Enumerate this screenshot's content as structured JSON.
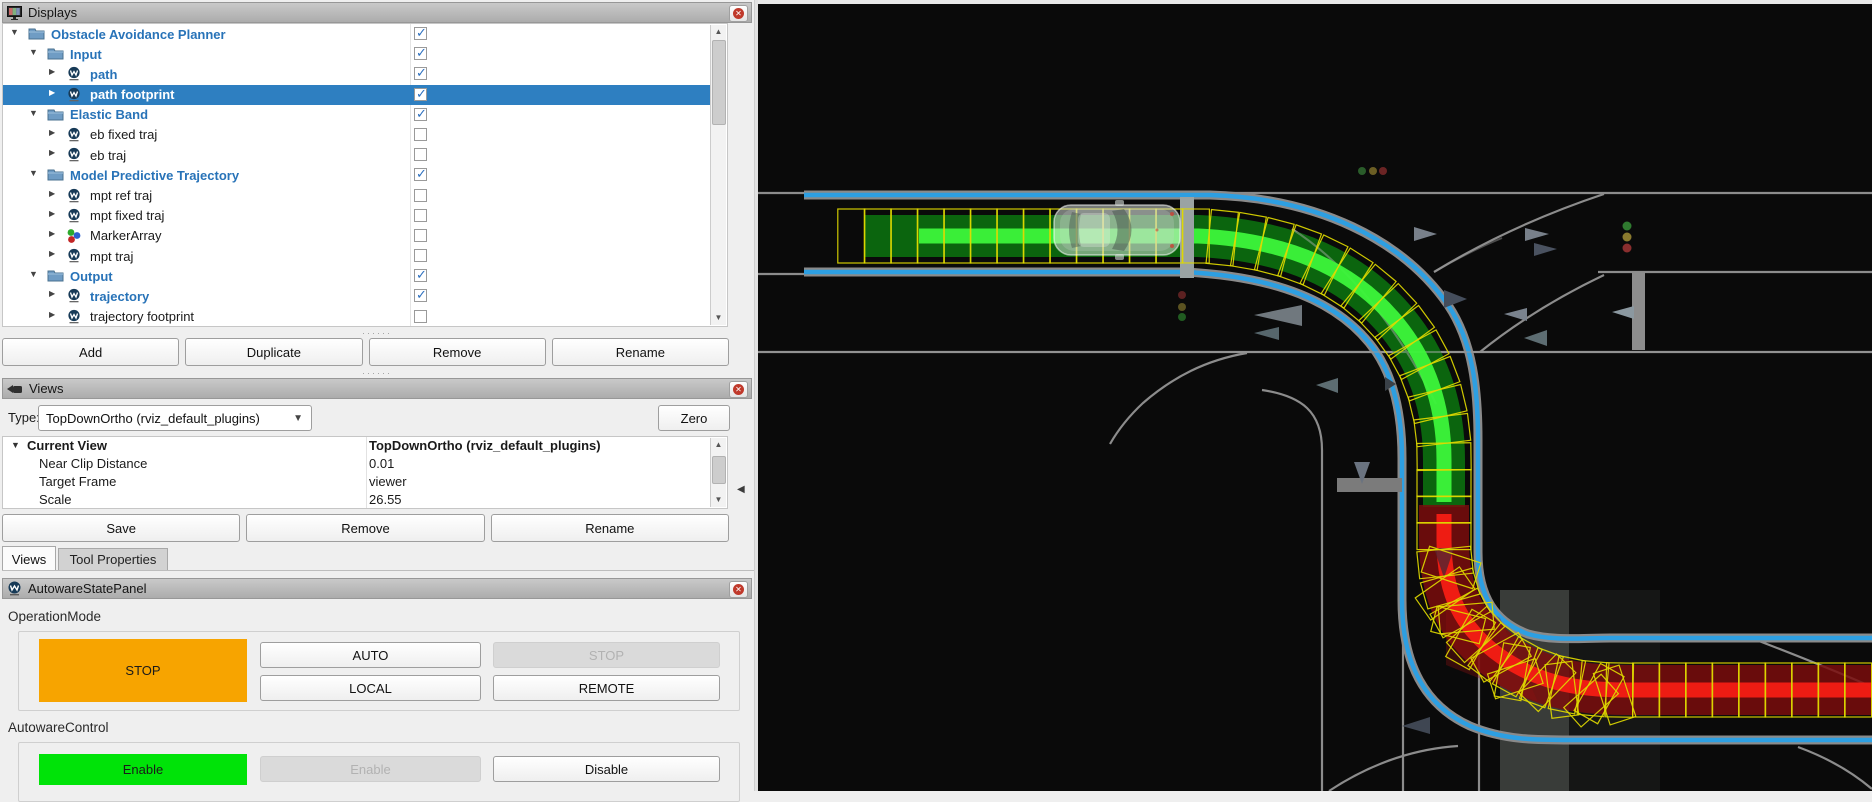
{
  "displays_panel": {
    "title": "Displays",
    "tree": [
      {
        "label": "Obstacle Avoidance Planner",
        "level": 0,
        "icon": "folder",
        "expanded": true,
        "checked": true,
        "blue": true,
        "selected": false
      },
      {
        "label": "Input",
        "level": 1,
        "icon": "folder",
        "expanded": true,
        "checked": true,
        "blue": true,
        "selected": false
      },
      {
        "label": "path",
        "level": 2,
        "icon": "autoware",
        "expanded": false,
        "checked": true,
        "blue": true,
        "selected": false
      },
      {
        "label": "path footprint",
        "level": 2,
        "icon": "autoware",
        "expanded": false,
        "checked": true,
        "blue": false,
        "selected": true
      },
      {
        "label": "Elastic Band",
        "level": 1,
        "icon": "folder",
        "expanded": true,
        "checked": true,
        "blue": true,
        "selected": false
      },
      {
        "label": "eb fixed traj",
        "level": 2,
        "icon": "autoware",
        "expanded": false,
        "checked": false,
        "blue": false,
        "selected": false
      },
      {
        "label": "eb traj",
        "level": 2,
        "icon": "autoware",
        "expanded": false,
        "checked": false,
        "blue": false,
        "selected": false
      },
      {
        "label": "Model Predictive Trajectory",
        "level": 1,
        "icon": "folder",
        "expanded": true,
        "checked": true,
        "blue": true,
        "selected": false
      },
      {
        "label": "mpt ref traj",
        "level": 2,
        "icon": "autoware",
        "expanded": false,
        "checked": false,
        "blue": false,
        "selected": false
      },
      {
        "label": "mpt fixed traj",
        "level": 2,
        "icon": "autoware",
        "expanded": false,
        "checked": false,
        "blue": false,
        "selected": false
      },
      {
        "label": "MarkerArray",
        "level": 2,
        "icon": "marker",
        "expanded": false,
        "checked": false,
        "blue": false,
        "selected": false
      },
      {
        "label": "mpt traj",
        "level": 2,
        "icon": "autoware",
        "expanded": false,
        "checked": false,
        "blue": false,
        "selected": false
      },
      {
        "label": "Output",
        "level": 1,
        "icon": "folder",
        "expanded": true,
        "checked": true,
        "blue": true,
        "selected": false
      },
      {
        "label": "trajectory",
        "level": 2,
        "icon": "autoware",
        "expanded": false,
        "checked": true,
        "blue": true,
        "selected": false
      },
      {
        "label": "trajectory footprint",
        "level": 2,
        "icon": "autoware",
        "expanded": false,
        "checked": false,
        "blue": false,
        "selected": false
      }
    ],
    "buttons": [
      "Add",
      "Duplicate",
      "Remove",
      "Rename"
    ]
  },
  "views_panel": {
    "title": "Views",
    "type_label": "Type:",
    "type_value": "TopDownOrtho (rviz_default_plugins)",
    "zero_button": "Zero",
    "properties": [
      {
        "name": "Current View",
        "value": "TopDownOrtho (rviz_default_plugins)",
        "bold": true,
        "expandable": true
      },
      {
        "name": "Near Clip Distance",
        "value": "0.01",
        "bold": false,
        "expandable": false
      },
      {
        "name": "Target Frame",
        "value": "viewer",
        "bold": false,
        "expandable": false
      },
      {
        "name": "Scale",
        "value": "26.55",
        "bold": false,
        "expandable": false
      }
    ],
    "buttons": [
      "Save",
      "Remove",
      "Rename"
    ],
    "tabs": [
      {
        "label": "Views",
        "active": true
      },
      {
        "label": "Tool Properties",
        "active": false
      }
    ]
  },
  "autoware_panel": {
    "title": "AutowareStatePanel",
    "operation_mode": {
      "label": "OperationMode",
      "status": "STOP",
      "status_color": "#f7a400",
      "buttons": [
        {
          "label": "AUTO",
          "enabled": true
        },
        {
          "label": "STOP",
          "enabled": false
        },
        {
          "label": "LOCAL",
          "enabled": true
        },
        {
          "label": "REMOTE",
          "enabled": true
        }
      ]
    },
    "autoware_control": {
      "label": "AutowareControl",
      "status": "Enable",
      "status_color": "#00e308",
      "buttons": [
        {
          "label": "Enable",
          "enabled": false
        },
        {
          "label": "Disable",
          "enabled": true
        }
      ]
    }
  },
  "viewport": {
    "background": "#0a0a0a",
    "colors": {
      "lane_boundary_blue": "#2d9fe2",
      "road_line_gray": "#8c8c8c",
      "path_area_green": "#0c7a10",
      "path_line_green": "#3df53b",
      "trajectory_area_red": "#7a0d0d",
      "trajectory_line_red": "#f51d14",
      "footprint_yellow": "#e0d900",
      "stop_line_gray": "#9aa3a3"
    },
    "elements": [
      "ego-vehicle",
      "path-footprint-boxes",
      "drivable-area-boundary",
      "reference-path-green",
      "output-trajectory-red",
      "stop-lines",
      "traffic-light-dots",
      "lane-direction-arrows",
      "crosswalk-band"
    ]
  }
}
